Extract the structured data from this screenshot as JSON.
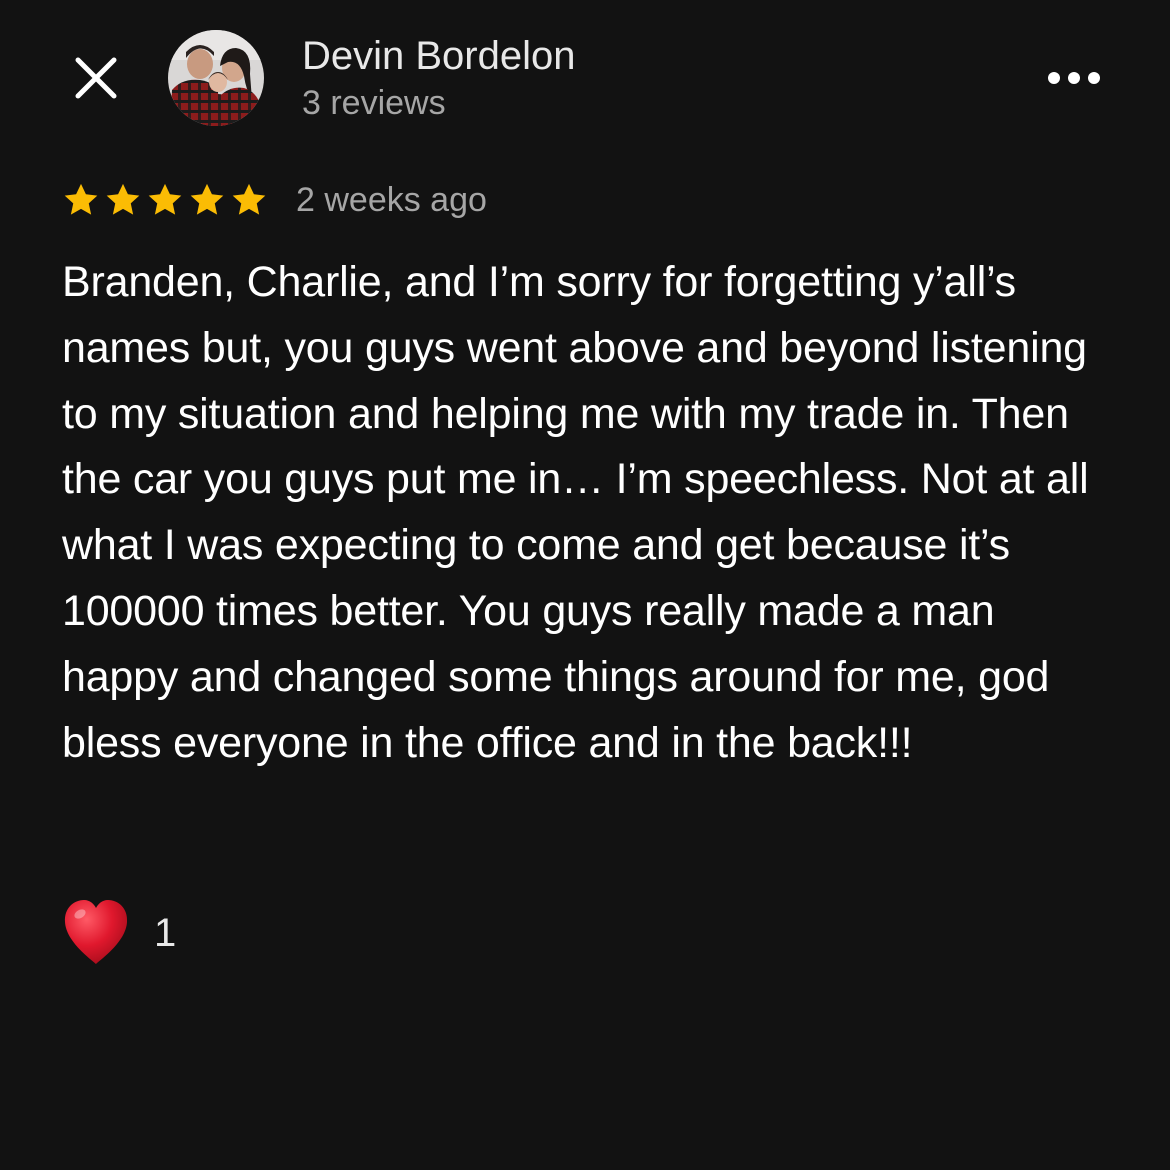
{
  "colors": {
    "background": "#121212",
    "star": "#fbbc04",
    "heart": "#e0182d",
    "secondary_text": "#a6a6a6"
  },
  "header": {
    "close_icon": "close-icon",
    "author_name": "Devin Bordelon",
    "review_count": "3 reviews",
    "more_icon": "more-horizontal-icon"
  },
  "review": {
    "rating": 5,
    "rating_max": 5,
    "date": "2 weeks ago",
    "text": "Branden, Charlie, and I’m sorry for forgetting y’all’s names but, you guys went above and beyond listening to my situation and helping me with my trade in. Then the car you guys put me in… I’m speechless. Not at all what I was expecting to come and get because it’s 100000 times better. You guys really made a man happy and changed some things around for me, god bless everyone in the office and in the back!!!"
  },
  "reaction": {
    "icon": "heart-icon",
    "count": "1"
  }
}
